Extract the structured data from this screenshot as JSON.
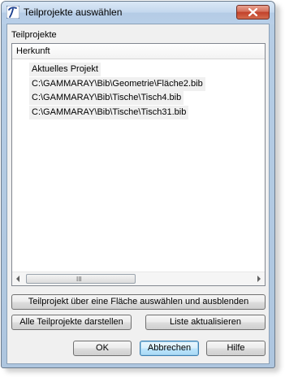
{
  "window": {
    "title": "Teilprojekte auswählen"
  },
  "group": {
    "label": "Teilprojekte"
  },
  "list": {
    "header": "Herkunft",
    "rows": [
      "Aktuelles Projekt",
      "C:\\GAMMARAY\\Bib\\Geometrie\\Fläche2.bib",
      "C:\\GAMMARAY\\Bib\\Tische\\Tisch4.bib",
      "C:\\GAMMARAY\\Bib\\Tische\\Tisch31.bib"
    ],
    "scroll_thumb_grip": "III"
  },
  "buttons": {
    "select_area_hide": "Teilprojekt über eine Fläche auswählen und ausblenden",
    "show_all": "Alle Teilprojekte darstellen",
    "refresh_list": "Liste aktualisieren",
    "ok": "OK",
    "cancel": "Abbrechen",
    "help": "Hilfe"
  }
}
